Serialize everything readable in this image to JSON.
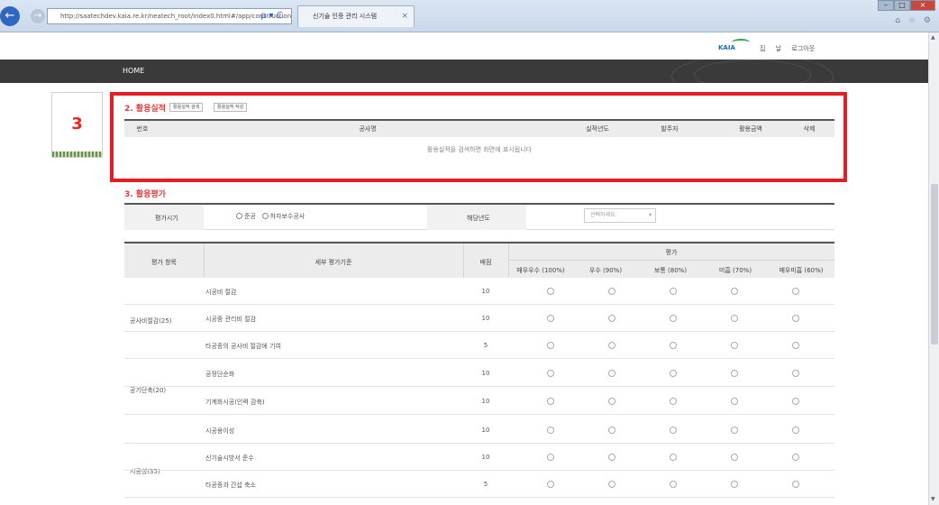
{
  "browser": {
    "back_icon": "back-arrow-icon",
    "forward_icon": "forward-arrow-icon",
    "url": "http://saatechdev.kaia.re.kr/neatech_root/index0.html#/app/construction/actio",
    "addr_controls": "ρ ▾ C",
    "tab_title": "신기술 인증 관리 시스템",
    "tab_close": "×",
    "win_minimize": "–",
    "win_maximize": "□",
    "win_close": "×",
    "right_icons": "⌂ ☆ ⚙"
  },
  "header": {
    "logo_text": "KAIA",
    "util_links": [
      "집",
      "날",
      "로그아웃"
    ],
    "nav_home": "HOME"
  },
  "side": {
    "badge_number": "3"
  },
  "section2": {
    "title": "2. 활용실적",
    "search_button": "활용실적 검색",
    "write_button": "활용실적 작성",
    "columns": [
      "번호",
      "공사명",
      "실적년도",
      "발주자",
      "활용금액",
      "삭제"
    ],
    "empty_message": "활용실적을 검색하면 화면에 표시됩니다"
  },
  "section3": {
    "title": "3. 활용평가",
    "filter": {
      "period_label": "평가시기",
      "radio_options": [
        "준공",
        "하자보수공사"
      ],
      "year_label": "해당년도",
      "select_placeholder": "선택하세요.",
      "select_caret": "▾"
    },
    "table_head": {
      "item": "평가 항목",
      "criteria": "세부 평가기준",
      "score": "배점",
      "eval": "평가",
      "levels": [
        "매우우수 (100%)",
        "우수 (90%)",
        "보통 (80%)",
        "미흡 (70%)",
        "매우미흡 (60%)"
      ]
    },
    "groups": [
      "공사비절감(25)",
      "공기단축(20)",
      "시공성(35)"
    ],
    "rows": [
      {
        "criteria": "시공비 절감",
        "score": "10"
      },
      {
        "criteria": "시공중 관리비 절감",
        "score": "10"
      },
      {
        "criteria": "타공종의 공사비 절감에 기여",
        "score": "5"
      },
      {
        "criteria": "공정단순화",
        "score": "10"
      },
      {
        "criteria": "기계화시공(인력 감축)",
        "score": "10"
      },
      {
        "criteria": "시공용이성",
        "score": "10"
      },
      {
        "criteria": "신기술시방서 준수",
        "score": "10"
      },
      {
        "criteria": "타공종과 간섭 축소",
        "score": "5"
      }
    ]
  },
  "scrollbar": {
    "up_arrow": "▲",
    "down_arrow": "▼"
  }
}
